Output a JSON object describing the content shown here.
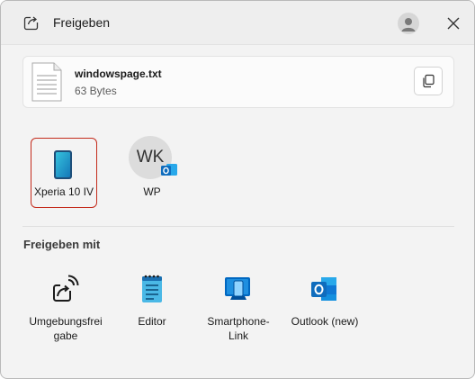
{
  "header": {
    "title": "Freigeben"
  },
  "file": {
    "name": "windowspage.txt",
    "size": "63 Bytes"
  },
  "devices": [
    {
      "label": "Xperia 10 IV"
    }
  ],
  "contacts": [
    {
      "initials": "WK",
      "label": "WP"
    }
  ],
  "share_with": {
    "title": "Freigeben mit",
    "apps": [
      {
        "label_line1": "Umgebungsfrei",
        "label_line2": "gabe"
      },
      {
        "label_line1": "Editor",
        "label_line2": ""
      },
      {
        "label_line1": "Smartphone-",
        "label_line2": "Link"
      },
      {
        "label_line1": "Outlook (new)",
        "label_line2": ""
      }
    ]
  },
  "colors": {
    "selection_border": "#c42b1c",
    "outlook_blue": "#0f6cbd",
    "phone_link_blue": "#0067c0"
  }
}
